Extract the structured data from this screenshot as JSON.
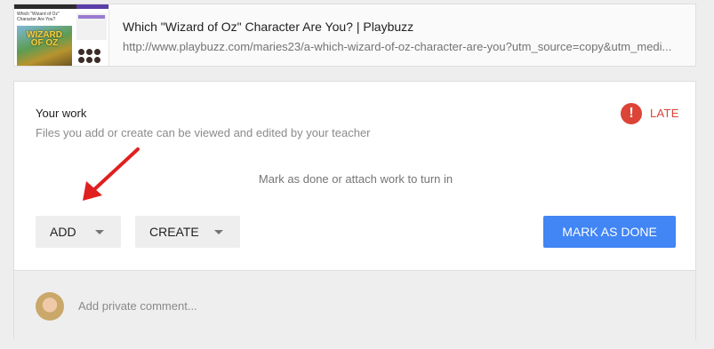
{
  "link": {
    "title": "Which \"Wizard of Oz\" Character Are You? | Playbuzz",
    "url": "http://www.playbuzz.com/maries23/a-which-wizard-of-oz-character-are-you?utm_source=copy&utm_medi...",
    "thumb_title": "Which \"Wizard of Oz\" Character Are You?",
    "thumb_word": "WIZARD OF OZ"
  },
  "work": {
    "title": "Your work",
    "subtitle": "Files you add or create can be viewed and edited by your teacher",
    "status_icon": "!",
    "status_label": "LATE",
    "hint": "Mark as done or attach work to turn in",
    "add_label": "ADD",
    "create_label": "CREATE",
    "done_label": "MARK AS DONE"
  },
  "comment": {
    "placeholder": "Add private comment..."
  },
  "colors": {
    "accent": "#4285f4",
    "late": "#db4437",
    "arrow": "#e02020"
  },
  "icons": {
    "late": "alert-circle-icon",
    "dropdown": "caret-down-icon",
    "annotation": "red-arrow-icon"
  }
}
